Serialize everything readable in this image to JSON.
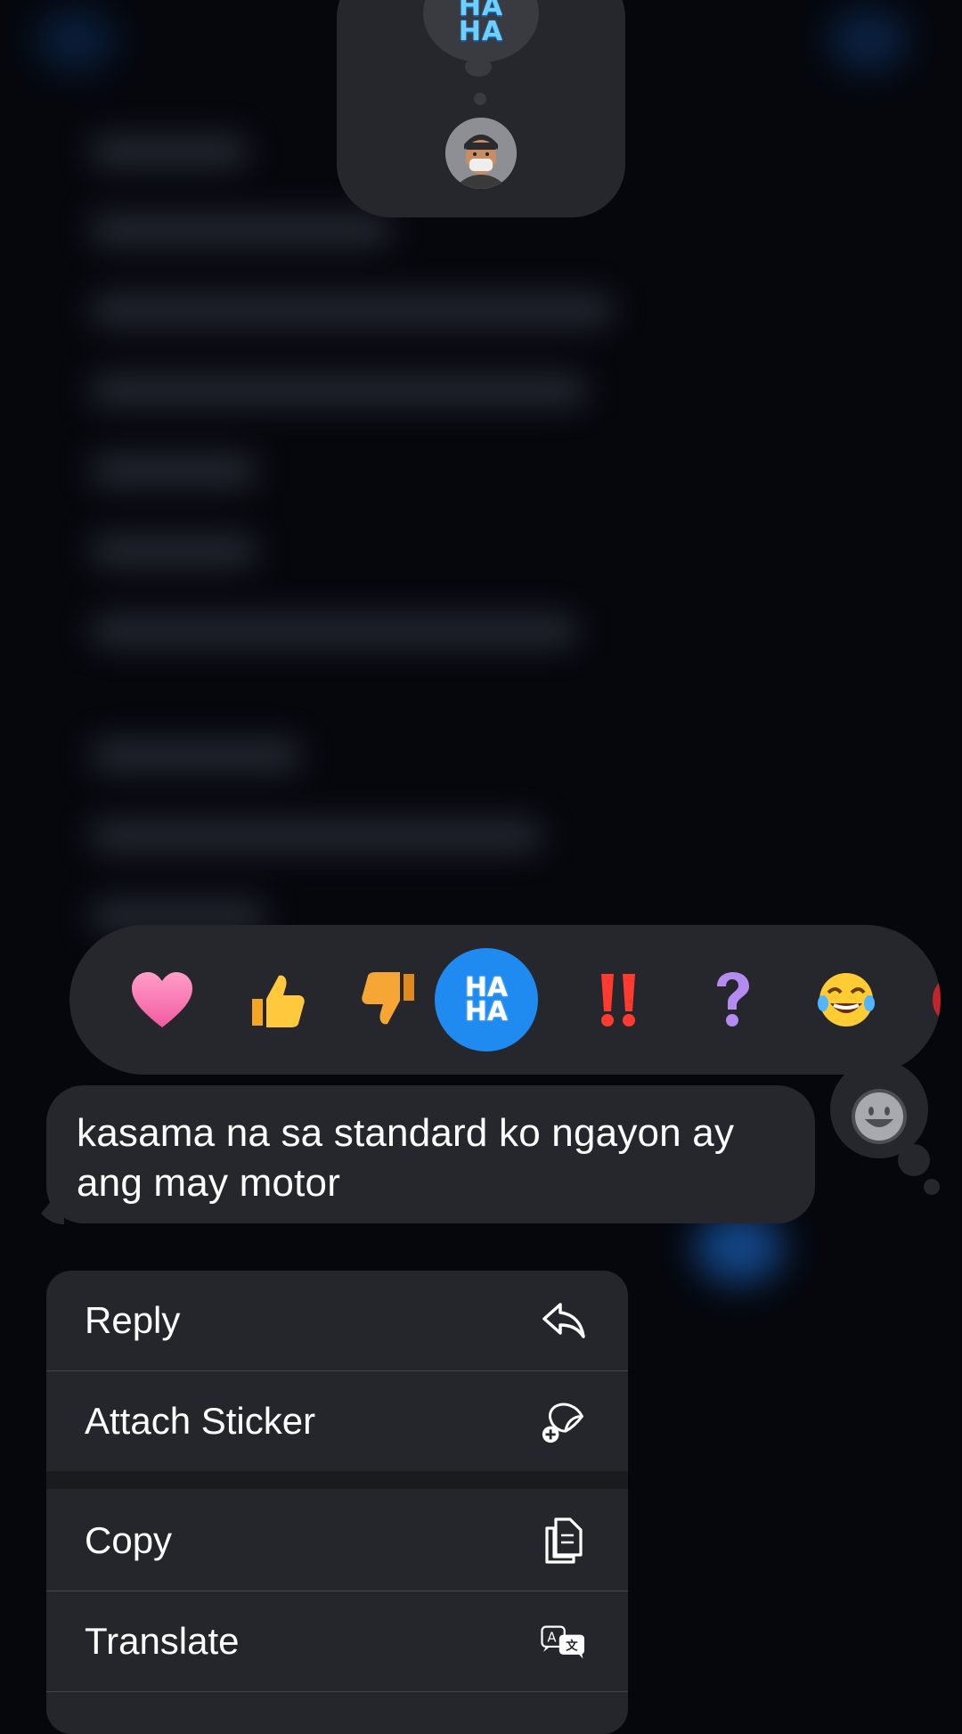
{
  "popover": {
    "reaction_text": "HA\nHA"
  },
  "tapbacks": [
    {
      "name": "heart",
      "glyph": "❤"
    },
    {
      "name": "thumbs-up",
      "glyph": "👍"
    },
    {
      "name": "thumbs-down",
      "glyph": "👎"
    },
    {
      "name": "haha",
      "glyph": "HA\nHA",
      "selected": true
    },
    {
      "name": "exclamation",
      "glyph": "‼"
    },
    {
      "name": "question",
      "glyph": "?"
    },
    {
      "name": "laughing",
      "glyph": "😂"
    }
  ],
  "message": {
    "text": "kasama na sa standard ko ngayon ay ang may motor"
  },
  "menu": {
    "reply": "Reply",
    "attach_sticker": "Attach Sticker",
    "copy": "Copy",
    "translate": "Translate"
  },
  "colors": {
    "accent": "#1f8bf0",
    "background": "#05070d",
    "surface": "#26272c"
  }
}
